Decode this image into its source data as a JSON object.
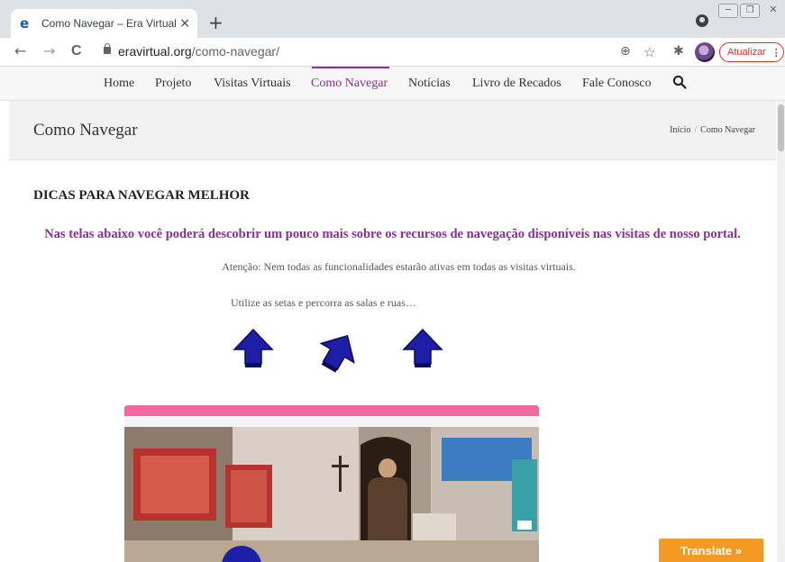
{
  "browser": {
    "tab": {
      "title": "Como Navegar – Era Virtual – Vis",
      "favicon": "e",
      "close": "×"
    },
    "new_tab": "+",
    "window_controls": {
      "minimize": "─",
      "restore": "❐",
      "close": "✕"
    },
    "nav": {
      "back": "←",
      "forward": "→",
      "reload": "C"
    },
    "address": {
      "domain": "eravirtual.org",
      "path": "/como-navegar/"
    },
    "icons": {
      "zoom": "zoom-icon",
      "star": "star-icon",
      "extensions": "puzzle-icon"
    },
    "toolbar_glyphs": {
      "zoom": "⊕",
      "star": "☆",
      "extensions": "✱"
    },
    "update_button": {
      "label": "Atualizar",
      "menu": "⋮"
    }
  },
  "site": {
    "menu": [
      {
        "label": "Home"
      },
      {
        "label": "Projeto"
      },
      {
        "label": "Visitas Virtuais"
      },
      {
        "label": "Como Navegar"
      },
      {
        "label": "Notícias"
      },
      {
        "label": "Livro de Recados"
      },
      {
        "label": "Fale Conosco"
      }
    ],
    "active_menu": "Como Navegar",
    "accent_color": "#8c2d9c",
    "page_title": "Como Navegar",
    "breadcrumb": {
      "home": "Início",
      "separator": "/",
      "current": "Como Navegar"
    }
  },
  "content": {
    "heading": "DICAS PARA NAVEGAR MELHOR",
    "lead": "Nas telas abaixo você poderá descobrir um pouco mais sobre os recursos de navegação disponíveis nas visitas de nosso portal.",
    "note": "Atenção: Nem todas as funcionalidades estarão ativas em todas as visitas virtuais.",
    "hint": "Utilize as setas e percorra as salas e ruas…",
    "arrow_color": "#1d1fa8"
  },
  "translate": {
    "label": "Translate »"
  }
}
